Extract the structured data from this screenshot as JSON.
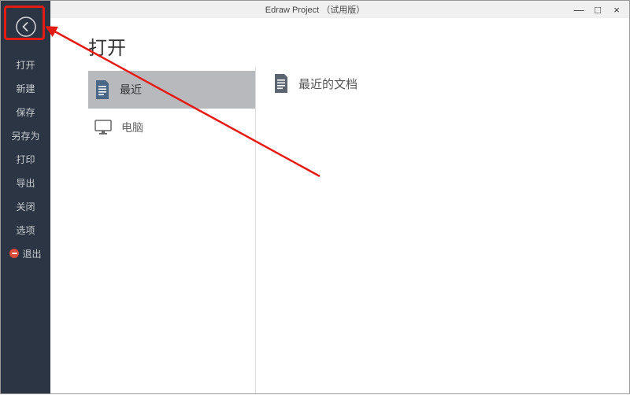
{
  "titlebar": {
    "title": "Edraw Project （试用版）",
    "minimize": "—",
    "maximize": "□",
    "close": "×"
  },
  "sidebar": {
    "items": [
      {
        "label": "打开"
      },
      {
        "label": "新建"
      },
      {
        "label": "保存"
      },
      {
        "label": "另存为"
      },
      {
        "label": "打印"
      },
      {
        "label": "导出"
      },
      {
        "label": "关闭"
      },
      {
        "label": "选项"
      },
      {
        "label": "退出"
      }
    ]
  },
  "page": {
    "title": "打开",
    "sources": [
      {
        "label": "最近"
      },
      {
        "label": "电脑"
      }
    ],
    "right_header": "最近的文档"
  },
  "colors": {
    "sidebar_bg": "#2b3543",
    "sidebar_text": "#c8ccd0",
    "selected_bg": "#b7b9bd",
    "annotation_red": "#e41b13",
    "exit_red": "#d94a3b"
  }
}
